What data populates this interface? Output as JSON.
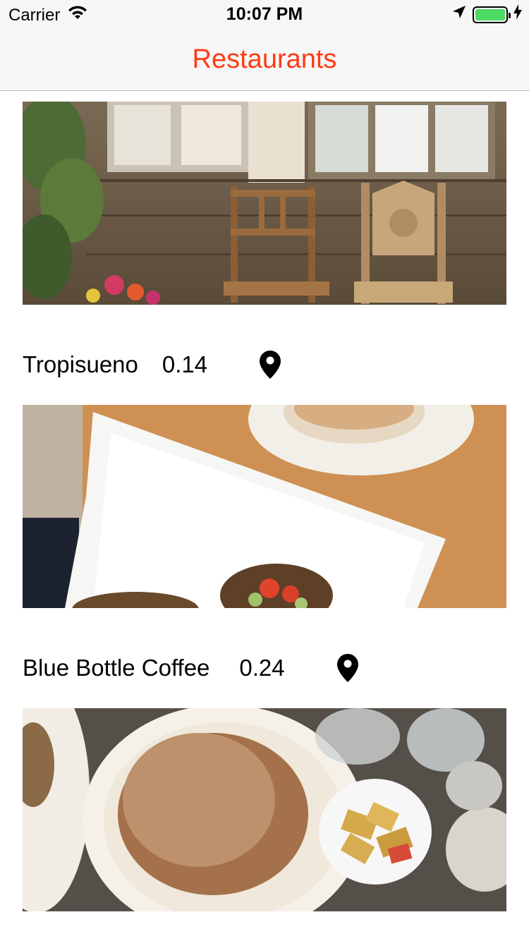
{
  "status_bar": {
    "carrier": "Carrier",
    "time": "10:07 PM",
    "icons": [
      "wifi-icon",
      "location-arrow-icon",
      "battery-icon",
      "charging-bolt-icon"
    ]
  },
  "nav": {
    "title": "Restaurants",
    "title_color": "#ff3b14"
  },
  "restaurants": [
    {
      "name": "",
      "distance": "",
      "image": "rustic wooden interior with chairs and flowers"
    },
    {
      "name": "Tropisueno",
      "distance": "0.14",
      "image": "avocado toast on white square plate with coffee"
    },
    {
      "name": "Blue Bottle Coffee",
      "distance": "0.24",
      "image": "pancakes with powdered sugar and butter"
    }
  ]
}
